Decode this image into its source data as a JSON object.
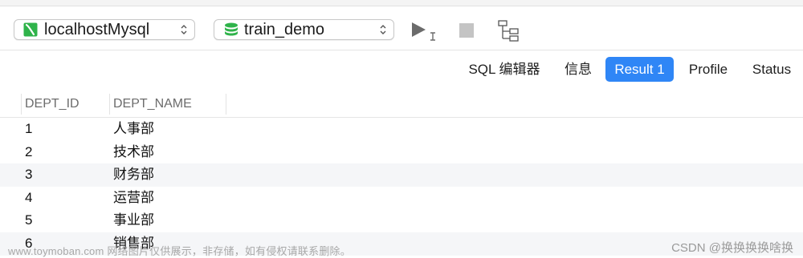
{
  "toolbar": {
    "connection": {
      "value": "localhostMysql",
      "icon": "mysql-connection-icon"
    },
    "database": {
      "value": "train_demo",
      "icon": "database-icon"
    },
    "run_icon": "run-icon",
    "stop_icon": "stop-icon",
    "explain_icon": "explain-icon"
  },
  "tabs": [
    {
      "label": "SQL 编辑器",
      "active": false
    },
    {
      "label": "信息",
      "active": false
    },
    {
      "label": "Result 1",
      "active": true
    },
    {
      "label": "Profile",
      "active": false
    },
    {
      "label": "Status",
      "active": false
    }
  ],
  "colors": {
    "accent": "#2f86f6",
    "row_alt": "#f5f6f8"
  },
  "grid": {
    "columns": [
      "DEPT_ID",
      "DEPT_NAME"
    ],
    "rows": [
      [
        "1",
        "人事部"
      ],
      [
        "2",
        "技术部"
      ],
      [
        "3",
        "财务部"
      ],
      [
        "4",
        "运营部"
      ],
      [
        "5",
        "事业部"
      ],
      [
        "6",
        "销售部"
      ]
    ]
  },
  "watermark": {
    "left": "www.toymoban.com 网络图片仅供展示，非存储，如有侵权请联系删除。",
    "right": "CSDN @换换换换啥换"
  }
}
